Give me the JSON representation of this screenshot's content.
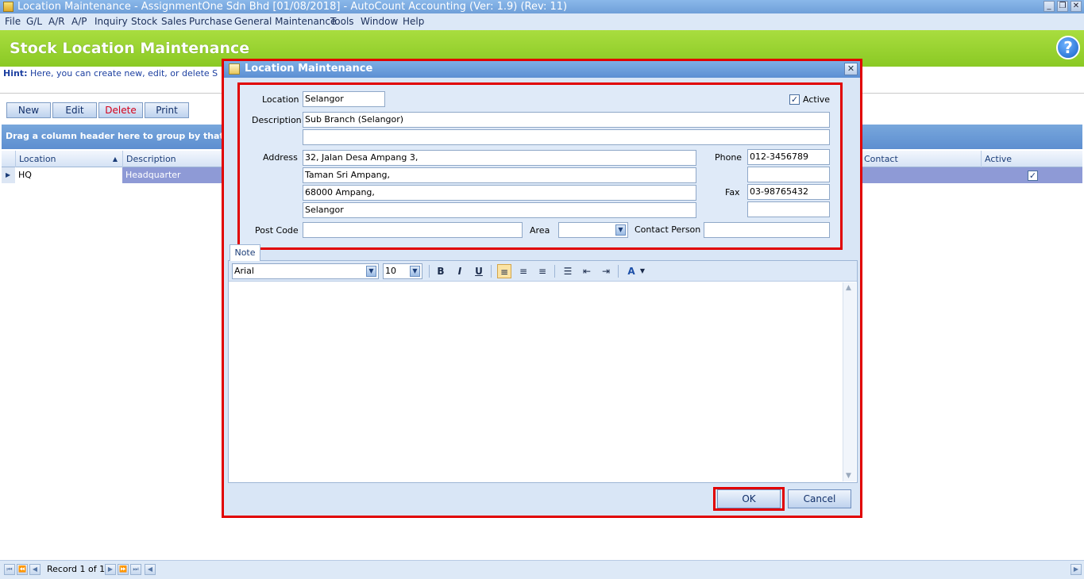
{
  "window": {
    "title": "Location Maintenance - AssignmentOne Sdn Bhd [01/08/2018] - AutoCount Accounting (Ver: 1.9) (Rev: 11)"
  },
  "menu": [
    "File",
    "G/L",
    "A/R",
    "A/P",
    "Inquiry",
    "Stock",
    "Sales",
    "Purchase",
    "General Maintenance",
    "Tools",
    "Window",
    "Help"
  ],
  "header": {
    "title": "Stock Location Maintenance",
    "help": "?"
  },
  "hint": {
    "label": "Hint:",
    "text": "Here, you can create new, edit, or delete S"
  },
  "toolbar": {
    "new": "New",
    "edit": "Edit",
    "delete": "Delete",
    "print": "Print"
  },
  "grid": {
    "group_hint": "Drag a column header here to group by that colu",
    "columns": {
      "location": "Location",
      "description": "Description",
      "contact": "Contact",
      "active": "Active"
    },
    "rows": [
      {
        "location": "HQ",
        "description": "Headquarter",
        "active": true
      }
    ]
  },
  "status": {
    "record": "Record 1 of 1"
  },
  "dialog": {
    "title": "Location Maintenance",
    "labels": {
      "location": "Location",
      "description": "Description",
      "address": "Address",
      "phone": "Phone",
      "fax": "Fax",
      "post_code": "Post Code",
      "area": "Area",
      "contact_person": "Contact Person",
      "active": "Active"
    },
    "values": {
      "location": "Selangor",
      "description1": "Sub Branch (Selangor)",
      "description2": "",
      "address1": "32, Jalan Desa Ampang 3,",
      "address2": "Taman Sri Ampang,",
      "address3": "68000 Ampang,",
      "address4": "Selangor",
      "phone1": "012-3456789",
      "phone2": "",
      "fax1": "03-98765432",
      "fax2": "",
      "post_code": "",
      "area": "",
      "contact_person": "",
      "active": true
    },
    "tab": "Note",
    "editor": {
      "font": "Arial",
      "size": "10"
    },
    "ok": "OK",
    "cancel": "Cancel"
  },
  "colors": {
    "highlight": "#e10000",
    "header_green": "#8ac924",
    "row_selected": "#8e9ad6"
  }
}
